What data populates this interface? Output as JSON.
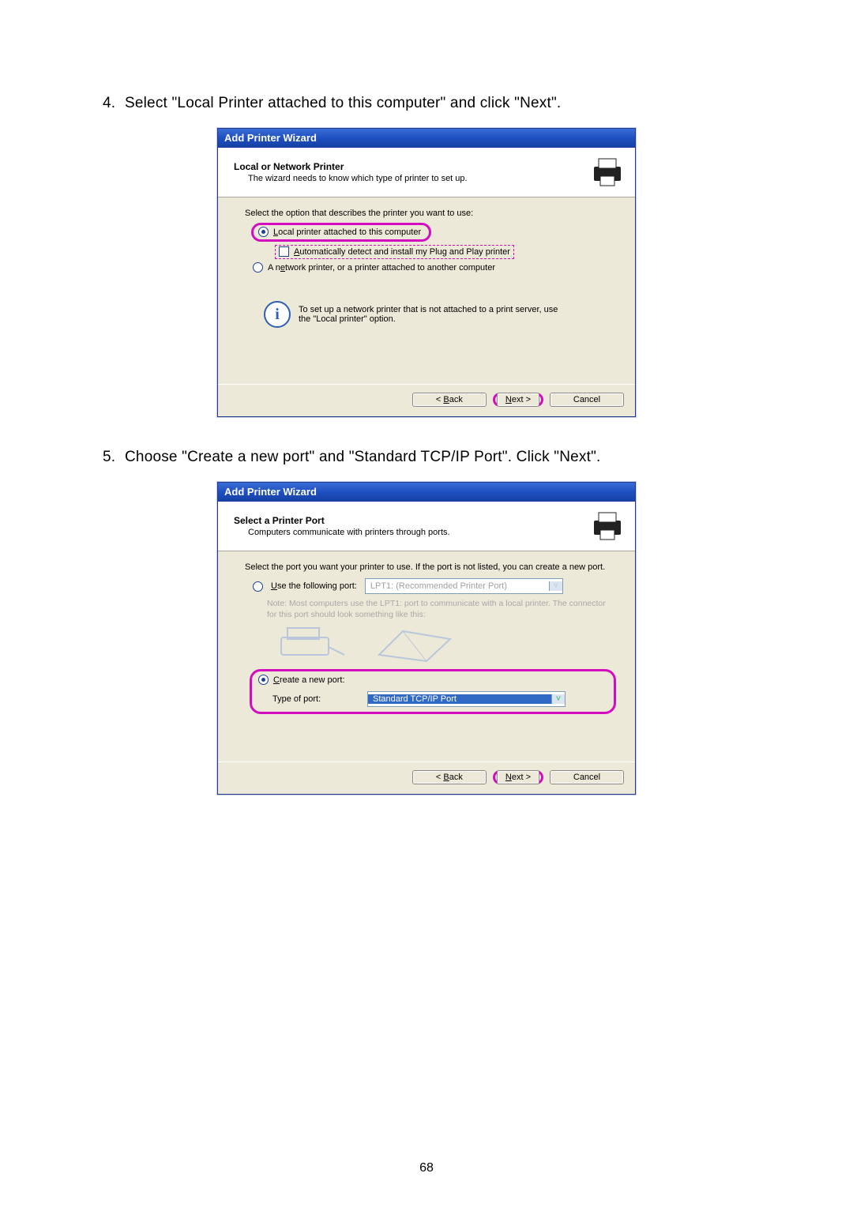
{
  "page_number": "68",
  "steps": {
    "s4": "Select \"Local Printer attached to this computer\" and click \"Next\".",
    "s5": "Choose \"Create a new port\" and \"Standard TCP/IP Port\". Click \"Next\"."
  },
  "wiz1": {
    "title": "Add Printer Wizard",
    "banner_title": "Local or Network Printer",
    "banner_sub": "The wizard needs to know which type of printer to set up.",
    "prompt": "Select the option that describes the printer you want to use:",
    "opt_local": "Local printer attached to this computer",
    "opt_auto": "Automatically detect and install my Plug and Play printer",
    "opt_net": "A network printer, or a printer attached to another computer",
    "info": "To set up a network printer that is not attached to a print server, use the \"Local printer\" option.",
    "back": "< Back",
    "next": "Next >",
    "cancel": "Cancel"
  },
  "wiz2": {
    "title": "Add Printer Wizard",
    "banner_title": "Select a Printer Port",
    "banner_sub": "Computers communicate with printers through ports.",
    "prompt": "Select the port you want your printer to use.  If the port is not listed, you can create a new port.",
    "opt_use": "Use the following port:",
    "use_value": "LPT1: (Recommended Printer Port)",
    "note": "Note: Most computers use the LPT1: port to communicate with a local printer. The connector for this port should look something like this:",
    "opt_create": "Create a new port:",
    "type_label": "Type of port:",
    "type_value": "Standard TCP/IP Port",
    "back": "< Back",
    "next": "Next >",
    "cancel": "Cancel"
  }
}
